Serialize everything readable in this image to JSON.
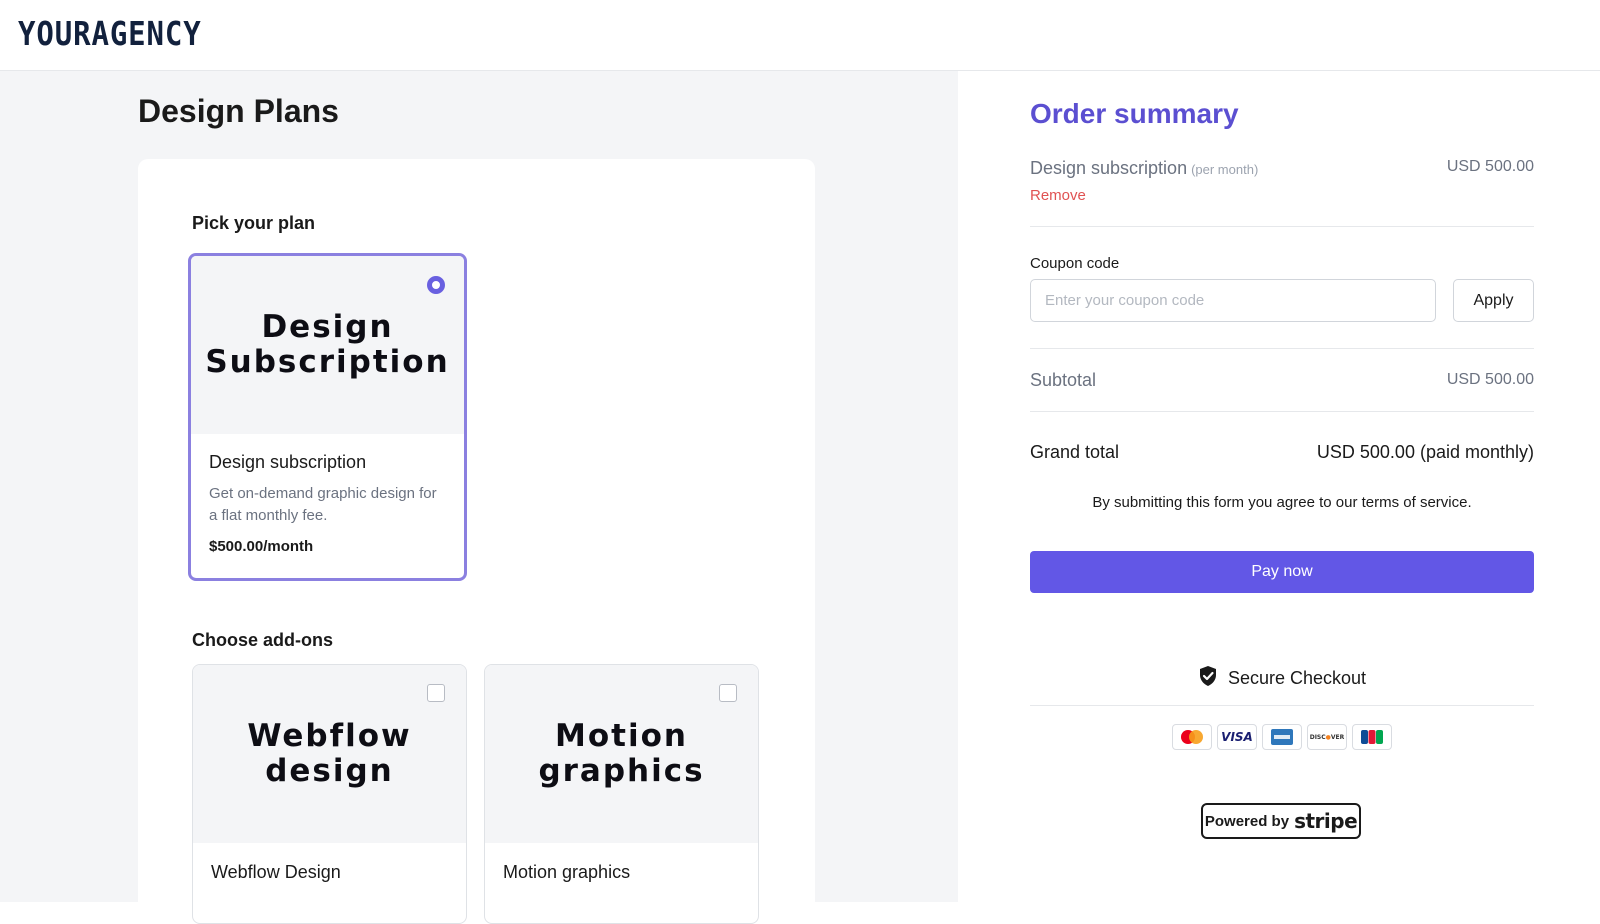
{
  "header": {
    "logo": "YOURAGENCY"
  },
  "main": {
    "title": "Design Plans",
    "plan_section_label": "Pick your plan",
    "plan": {
      "hero_text": "Design\nSubscription",
      "name": "Design subscription",
      "description": "Get on-demand graphic design for a flat monthly fee.",
      "price": "$500.00/month",
      "selected": true
    },
    "addons_section_label": "Choose add-ons",
    "addons": [
      {
        "hero_text": "Webflow\ndesign",
        "name": "Webflow Design",
        "checked": false
      },
      {
        "hero_text": "Motion\ngraphics",
        "name": "Motion graphics",
        "checked": false
      }
    ]
  },
  "summary": {
    "title": "Order summary",
    "line_item": {
      "name": "Design subscription",
      "period": "(per month)",
      "price": "USD 500.00",
      "remove_label": "Remove"
    },
    "coupon": {
      "label": "Coupon code",
      "placeholder": "Enter your coupon code",
      "value": "",
      "apply_label": "Apply"
    },
    "subtotal": {
      "label": "Subtotal",
      "value": "USD 500.00"
    },
    "grand_total": {
      "label": "Grand total",
      "value": "USD 500.00 (paid monthly)"
    },
    "terms": "By submitting this form you agree to our terms of service.",
    "pay_label": "Pay now",
    "secure_label": "Secure Checkout",
    "payment_methods": [
      "mastercard-icon",
      "visa-icon",
      "amex-icon",
      "discover-icon",
      "jcb-icon"
    ],
    "powered_by": {
      "prefix": "Powered by",
      "brand": "stripe"
    }
  },
  "colors": {
    "accent": "#6257e6",
    "title_accent": "#5b4fd1",
    "remove_red": "#e05252",
    "panel_gray": "#f4f5f7"
  }
}
